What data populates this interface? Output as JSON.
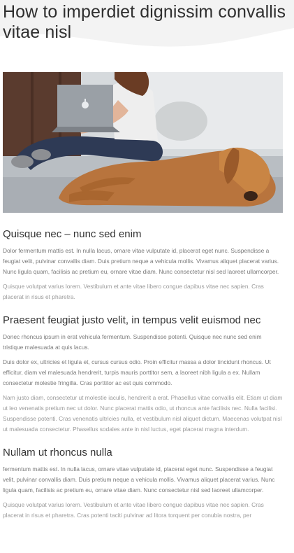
{
  "page": {
    "title": "How to imperdiet dignissim convallis vitae nisl"
  },
  "photo": {
    "alt": "",
    "laptop_icon": "apple-logo-icon"
  },
  "sections": [
    {
      "title": "Quisque nec – nunc sed enim",
      "paragraphs": [
        "Dolor fermentum mattis est. In nulla lacus, ornare vitae vulputate id, placerat eget nunc. Suspendisse a feugiat velit, pulvinar convallis diam. Duis pretium neque a vehicula mollis. Vivamus aliquet placerat varius. Nunc ligula quam, facilisis ac pretium eu, ornare vitae diam. Nunc consectetur nisl sed laoreet ullamcorper.",
        "Quisque volutpat varius lorem. Vestibulum et ante vitae libero congue dapibus vitae nec sapien. Cras placerat in risus et pharetra."
      ]
    },
    {
      "title": "Praesent feugiat justo velit, in tempus velit euismod nec",
      "paragraphs": [
        "Donec rhoncus ipsum in erat vehicula fermentum. Suspendisse potenti. Quisque nec nunc sed enim tristique malesuada at quis lacus.",
        "Duis dolor ex, ultricies et ligula et, cursus cursus odio. Proin efficitur massa a dolor tincidunt rhoncus. Ut efficitur, diam vel malesuada hendrerit, turpis mauris porttitor sem, a laoreet nibh ligula a ex. Nullam consectetur molestie fringilla. Cras porttitor ac est quis commodo.",
        "Nam justo diam, consectetur ut molestie iaculis, hendrerit a erat. Phasellus vitae convallis elit. Etiam ut diam ut leo venenatis pretium nec ut dolor. Nunc placerat mattis odio, ut rhoncus ante facilisis nec. Nulla facilisi. Suspendisse potenti. Cras venenatis ultricies nulla, et vestibulum nisl aliquet dictum. Maecenas volutpat nisl ut malesuada consectetur. Phasellus sodales ante in nisl luctus, eget placerat magna interdum."
      ]
    },
    {
      "title": "Nullam ut rhoncus nulla",
      "paragraphs": [
        "fermentum mattis est. In nulla lacus, ornare vitae vulputate id, placerat eget nunc. Suspendisse a feugiat velit, pulvinar convallis diam. Duis pretium neque a vehicula mollis. Vivamus aliquet placerat varius. Nunc ligula quam, facilisis ac pretium eu, ornare vitae diam. Nunc consectetur nisl sed laoreet ullamcorper.",
        "Quisque volutpat varius lorem. Vestibulum et ante vitae libero congue dapibus vitae nec sapien. Cras placerat in risus et pharetra. Cras potenti taciti pulvinar ad litora torquent per conubia nostra, per"
      ]
    }
  ]
}
